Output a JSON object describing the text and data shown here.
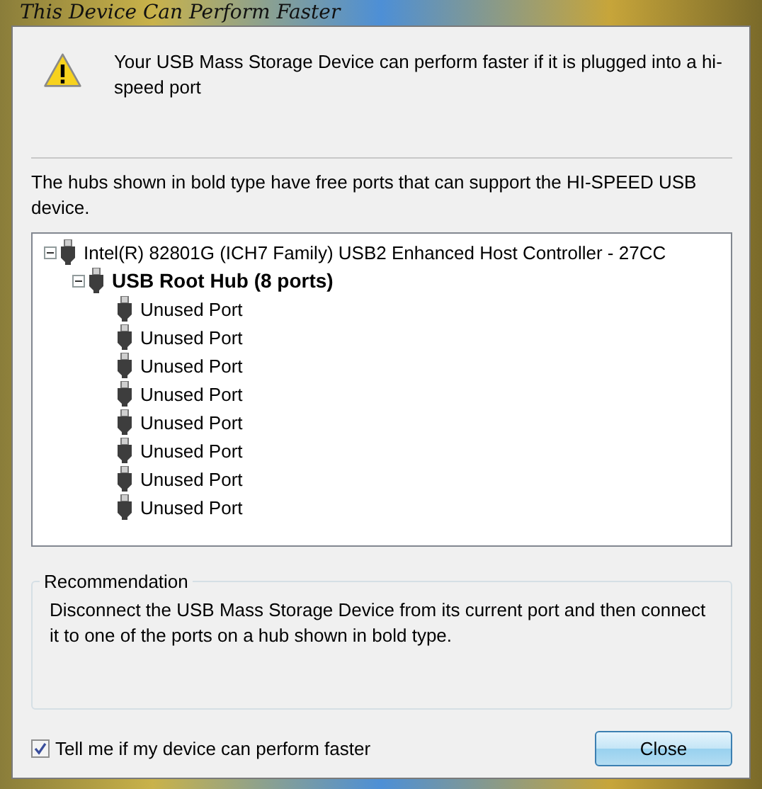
{
  "window": {
    "title": "This Device Can Perform Faster"
  },
  "warning": "Your USB Mass Storage Device can perform faster if it is plugged into a hi-speed port",
  "hint": "The hubs shown in bold type have free ports that can support the HI-SPEED USB device.",
  "tree": [
    {
      "label": "Intel(R) 82801G (ICH7 Family) USB2 Enhanced Host Controller - 27CC",
      "bold": false,
      "expanded": true,
      "children": [
        {
          "label": "USB Root Hub (8 ports)",
          "bold": true,
          "expanded": true,
          "children": [
            {
              "label": "Unused Port",
              "bold": false
            },
            {
              "label": "Unused Port",
              "bold": false
            },
            {
              "label": "Unused Port",
              "bold": false
            },
            {
              "label": "Unused Port",
              "bold": false
            },
            {
              "label": "Unused Port",
              "bold": false
            },
            {
              "label": "Unused Port",
              "bold": false
            },
            {
              "label": "Unused Port",
              "bold": false
            },
            {
              "label": "Unused Port",
              "bold": false
            }
          ]
        }
      ]
    }
  ],
  "recommendation": {
    "title": "Recommendation",
    "text": "Disconnect the USB Mass Storage Device from its current port and then connect it to one of the ports on a hub shown in bold type."
  },
  "checkbox": {
    "label": "Tell me if my device can perform faster",
    "checked": true
  },
  "buttons": [
    "Close"
  ]
}
